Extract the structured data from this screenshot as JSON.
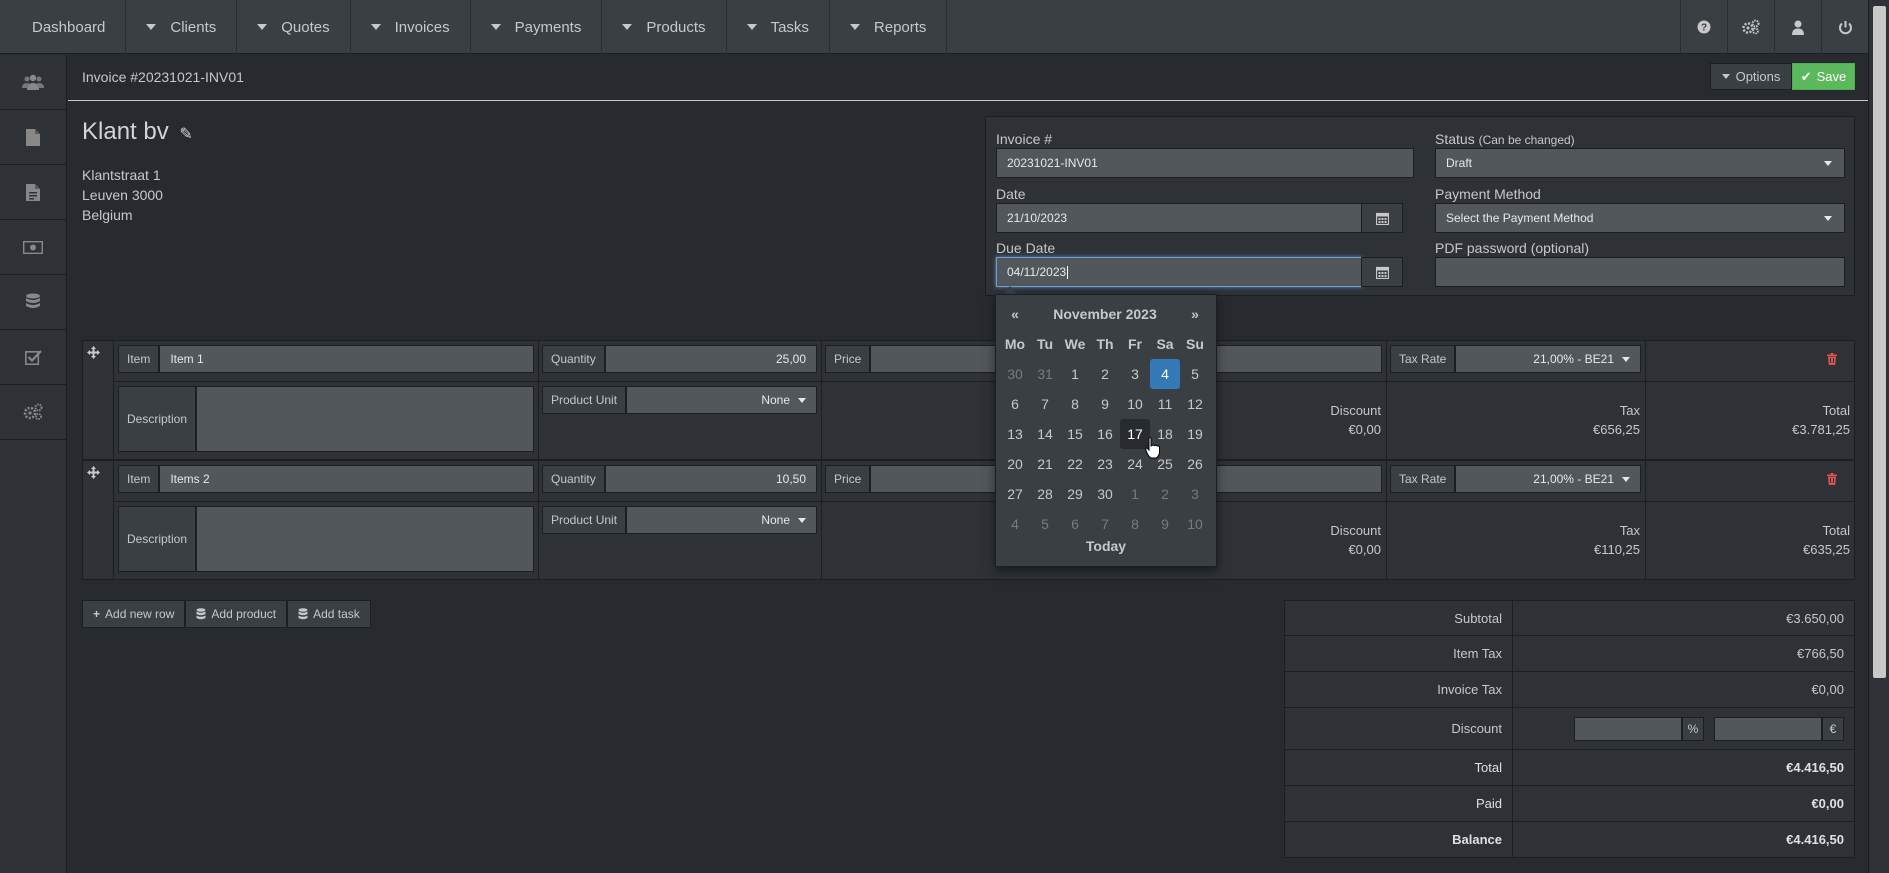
{
  "nav": {
    "items": [
      {
        "label": "Dashboard",
        "dropdown": false
      },
      {
        "label": "Clients",
        "dropdown": true
      },
      {
        "label": "Quotes",
        "dropdown": true
      },
      {
        "label": "Invoices",
        "dropdown": true
      },
      {
        "label": "Payments",
        "dropdown": true
      },
      {
        "label": "Products",
        "dropdown": true
      },
      {
        "label": "Tasks",
        "dropdown": true
      },
      {
        "label": "Reports",
        "dropdown": true
      }
    ],
    "right_icons": [
      "help-icon",
      "settings-icon",
      "user-icon",
      "power-icon"
    ]
  },
  "sidebar": {
    "icons": [
      "clients-icon",
      "quotes-icon",
      "invoices-icon",
      "payments-icon",
      "products-icon",
      "tasks-icon",
      "settings-icon"
    ]
  },
  "header": {
    "title": "Invoice #20231021-INV01",
    "options_label": "Options",
    "save_label": "Save"
  },
  "client": {
    "name": "Klant bv",
    "address": [
      "Klantstraat 1",
      "Leuven 3000",
      "Belgium"
    ]
  },
  "invoice": {
    "number_label": "Invoice #",
    "number": "20231021-INV01",
    "status_label": "Status",
    "status_hint": "(Can be changed)",
    "status": "Draft",
    "date_label": "Date",
    "date": "21/10/2023",
    "payment_method_label": "Payment Method",
    "payment_method": "Select the Payment Method",
    "due_date_label": "Due Date",
    "due_date": "04/11/2023",
    "pdf_password_label": "PDF password (optional)",
    "pdf_password": ""
  },
  "datepicker": {
    "prev": "«",
    "next": "»",
    "month": "November 2023",
    "weekdays": [
      "Mo",
      "Tu",
      "We",
      "Th",
      "Fr",
      "Sa",
      "Su"
    ],
    "weeks": [
      [
        "30",
        "31",
        "1",
        "2",
        "3",
        "4",
        "5"
      ],
      [
        "6",
        "7",
        "8",
        "9",
        "10",
        "11",
        "12"
      ],
      [
        "13",
        "14",
        "15",
        "16",
        "17",
        "18",
        "19"
      ],
      [
        "20",
        "21",
        "22",
        "23",
        "24",
        "25",
        "26"
      ],
      [
        "27",
        "28",
        "29",
        "30",
        "1",
        "2",
        "3"
      ],
      [
        "4",
        "5",
        "6",
        "7",
        "8",
        "9",
        "10"
      ]
    ],
    "today_label": "Today"
  },
  "items": [
    {
      "item_label": "Item",
      "item": "Item 1",
      "quantity_label": "Quantity",
      "quantity": "25,00",
      "price_label": "Price",
      "tax_rate_label": "Tax Rate",
      "tax_rate": "21,00% - BE21",
      "description_label": "Description",
      "product_unit_label": "Product Unit",
      "product_unit": "None",
      "discount_label": "Discount",
      "discount": "€0,00",
      "tax_label": "Tax",
      "tax": "€656,25",
      "total_label": "Total",
      "total": "€3.781,25"
    },
    {
      "item_label": "Item",
      "item": "Items 2",
      "quantity_label": "Quantity",
      "quantity": "10,50",
      "price_label": "Price",
      "tax_rate_label": "Tax Rate",
      "tax_rate": "21,00% - BE21",
      "description_label": "Description",
      "product_unit_label": "Product Unit",
      "product_unit": "None",
      "discount_label": "Discount",
      "discount": "€0,00",
      "tax_label": "Tax",
      "tax": "€110,25",
      "total_label": "Total",
      "total": "€635,25"
    }
  ],
  "actions": {
    "add_row": "Add new row",
    "add_product": "Add product",
    "add_task": "Add task"
  },
  "totals": {
    "subtotal_label": "Subtotal",
    "subtotal": "€3.650,00",
    "item_tax_label": "Item Tax",
    "item_tax": "€766,50",
    "invoice_tax_label": "Invoice Tax",
    "invoice_tax": "€0,00",
    "discount_label": "Discount",
    "discount_pct_suffix": "%",
    "discount_amount_suffix": "€",
    "total_label": "Total",
    "total": "€4.416,50",
    "paid_label": "Paid",
    "paid": "€0,00",
    "balance_label": "Balance",
    "balance": "€4.416,50"
  },
  "colors": {
    "background": "#272b30",
    "navbar": "#3a3f44",
    "input": "#52575c",
    "save": "#5cb85c",
    "active_day": "#337ab7",
    "delete": "#d9534f"
  }
}
